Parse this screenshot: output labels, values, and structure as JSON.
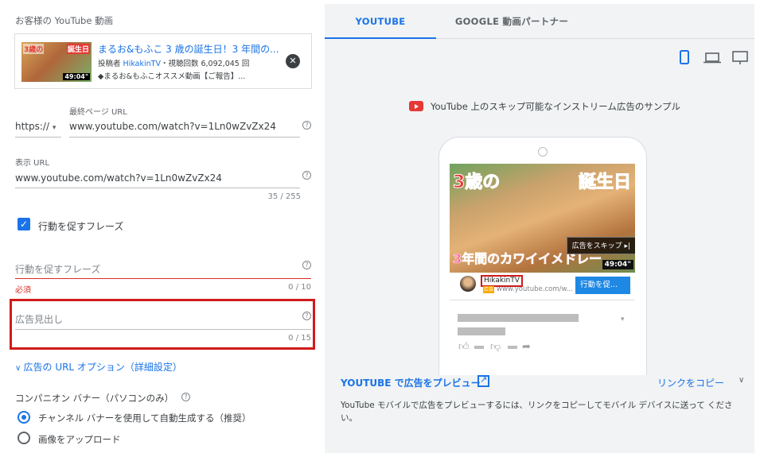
{
  "left": {
    "video_section_label": "お客様の YouTube 動画",
    "video": {
      "thumb_text_left": "3歳の",
      "thumb_text_right": "誕生日",
      "thumb_duration": "49:04\"",
      "title": "まるお&もふこ 3 歳の誕生日！3 年間の...",
      "meta_prefix": "投稿者",
      "channel": "HikakinTV",
      "meta_views": "・視聴回数 6,092,045 回",
      "description": "◆まるお&もふこオススメ動画【ご報告】..."
    },
    "final_url_label": "最終ページ URL",
    "protocol": "https://",
    "final_url": "www.youtube.com/watch?v=1Ln0wZvZx24",
    "display_url_label": "表示 URL",
    "display_url": "www.youtube.com/watch?v=1Ln0wZvZx24",
    "display_url_counter": "35 / 255",
    "cta_checkbox_label": "行動を促すフレーズ",
    "cta_field_placeholder": "行動を促すフレーズ",
    "cta_required": "必須",
    "cta_counter": "0 / 10",
    "headline_placeholder": "広告見出し",
    "headline_counter": "0 / 15",
    "url_options_link": "広告の URL オプション（詳細設定）",
    "companion_banner_label": "コンパニオン バナー（パソコンのみ）",
    "radio_auto": "チャンネル バナーを使用して自動生成する（推奨）",
    "radio_upload": "画像をアップロード"
  },
  "right": {
    "tab_youtube": "YOUTUBE",
    "tab_partner": "GOOGLE 動画パートナー",
    "sample_caption": "YouTube 上のスキップ可能なインストリーム広告のサンプル",
    "ad_text_top_left": "3歳の",
    "ad_text_top_right": "誕生日",
    "ad_text_bottom": "3年間のカワイイメドレー",
    "skip_label": "広告をスキップ ▸|",
    "ad_duration": "49:04\"",
    "channel_name": "HikakinTV",
    "ad_badge": "広告",
    "display_url_short": "www.youtube.com/w...",
    "cta_button": "行動を促...",
    "preview_link": "YOUTUBE で広告をプレビュー",
    "copy_link": "リンクをコピー",
    "preview_note": "YouTube モバイルで広告をプレビューするには、リンクをコピーしてモバイル デバイスに送って ください。"
  },
  "colors": {
    "accent": "#1a73e8",
    "highlight_box": "#d01a1a",
    "panel_bg": "#f1f3f4"
  }
}
